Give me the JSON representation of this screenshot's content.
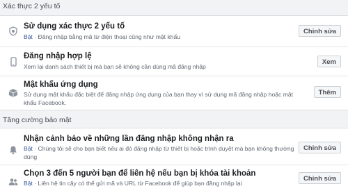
{
  "two_factor": {
    "header": "Xác thực 2 yếu tố",
    "items": [
      {
        "title": "Sử dụng xác thực 2 yếu tố",
        "status": "Bật",
        "description": "Đăng nhập bằng mã từ điện thoại cũng như mật khẩu",
        "button": "Chỉnh sửa",
        "icon": "shield-icon"
      },
      {
        "title": "Đăng nhập hợp lệ",
        "status": "",
        "description": "Xem lại danh sách thiết bị mà bạn sẽ không cần dùng mã đăng nhập",
        "button": "Xem",
        "icon": "phone-icon"
      },
      {
        "title": "Mật khẩu ứng dụng",
        "status": "",
        "description": "Sử dụng mật khẩu đặc biệt để đăng nhập ứng dụng của bạn thay vì sử dụng mã đăng nhập hoặc mật khẩu Facebook.",
        "button": "Thêm",
        "icon": "box-icon"
      }
    ]
  },
  "extra_security": {
    "header": "Tăng cường bảo mật",
    "items": [
      {
        "title": "Nhận cảnh báo về những lần đăng nhập không nhận ra",
        "status": "Bật",
        "description": "Chúng tôi sẽ cho bạn biết nếu ai đó đăng nhập từ thiết bị hoặc trình duyệt mà bạn không thường dùng",
        "button": "Chỉnh sửa",
        "icon": "bell-icon"
      },
      {
        "title": "Chọn 3 đến 5 người bạn để liên hệ nếu bạn bị khóa tài khoản",
        "status": "Bật",
        "description": "Liên hệ tin cậy có thể gửi mã và URL từ Facebook để giúp bạn đăng nhập lại",
        "button": "Chỉnh sửa",
        "icon": "friends-icon"
      }
    ]
  }
}
